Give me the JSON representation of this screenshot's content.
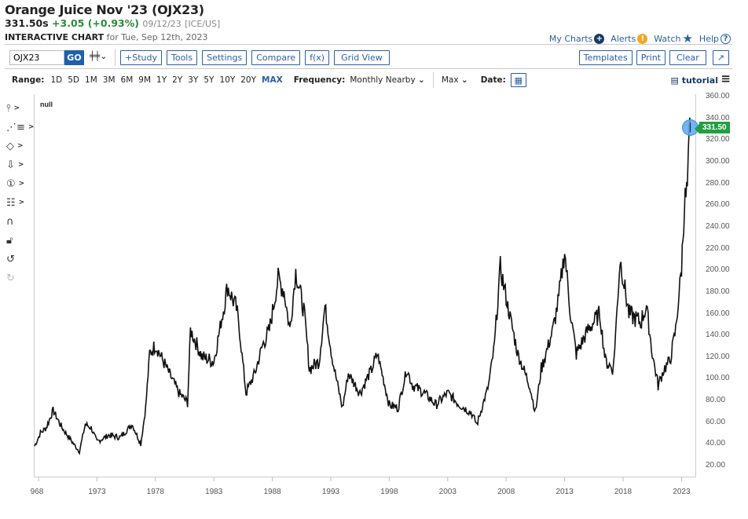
{
  "header": {
    "title": "Orange Juice Nov '23 (OJX23)",
    "price": "331.50s",
    "change": "+3.05 (+0.93%)",
    "date": "09/12/23",
    "exchange": "[ICE/US]",
    "sub_bold": "INTERACTIVE CHART",
    "sub_rest": "for Tue, Sep 12th, 2023"
  },
  "links": {
    "my_charts": "My Charts",
    "alerts": "Alerts",
    "watch": "Watch",
    "help": "Help"
  },
  "toolbar": {
    "symbol": "OJX23",
    "go": "GO",
    "study": "+Study",
    "tools": "Tools",
    "settings": "Settings",
    "compare": "Compare",
    "fx": "f(x)",
    "grid": "Grid View",
    "templates": "Templates",
    "print": "Print",
    "clear": "Clear",
    "expand": "↗"
  },
  "range": {
    "label": "Range:",
    "options": [
      "1D",
      "5D",
      "1M",
      "3M",
      "6M",
      "9M",
      "1Y",
      "2Y",
      "3Y",
      "5Y",
      "10Y",
      "20Y",
      "MAX"
    ],
    "active": "MAX",
    "freq_label": "Frequency:",
    "freq_value": "Monthly Nearby",
    "agg_value": "Max",
    "date_label": "Date:",
    "tutorial": "tutorial"
  },
  "left_tools": [
    "crosshair",
    "trendlines",
    "shapes",
    "arrow",
    "annotation-number",
    "fibonacci",
    "magnet",
    "lock",
    "undo",
    "redo"
  ],
  "colors": {
    "accent": "#2a5ea8",
    "up": "#2a8a3a",
    "last_price_badge": "#20a040",
    "marker": "#5aa8f0"
  },
  "chart_data": {
    "type": "line",
    "legend_text": "null",
    "last_value": "331.50",
    "ylim": [
      10,
      362
    ],
    "y_ticks": [
      "360.00",
      "340.00",
      "320.00",
      "300.00",
      "280.00",
      "260.00",
      "240.00",
      "220.00",
      "200.00",
      "180.00",
      "160.00",
      "140.00",
      "120.00",
      "100.00",
      "80.00",
      "60.00",
      "40.00",
      "20.00"
    ],
    "x_ticks": [
      "968",
      "1973",
      "1978",
      "1983",
      "1988",
      "1993",
      "1998",
      "2003",
      "2008",
      "2013",
      "2018",
      "2023"
    ],
    "grid": false,
    "series": [
      {
        "points": [
          [
            "1967-09",
            38
          ],
          [
            "1968-03",
            50
          ],
          [
            "1968-09",
            55
          ],
          [
            "1969-04",
            71
          ],
          [
            "1970-01",
            55
          ],
          [
            "1971-01",
            40
          ],
          [
            "1971-07",
            33
          ],
          [
            "1972-01",
            58
          ],
          [
            "1972-07",
            55
          ],
          [
            "1973-01",
            42
          ],
          [
            "1974-01",
            48
          ],
          [
            "1975-01",
            46
          ],
          [
            "1976-01",
            58
          ],
          [
            "1976-10",
            40
          ],
          [
            "1977-03",
            73
          ],
          [
            "1977-07",
            123
          ],
          [
            "1978-01",
            131
          ],
          [
            "1979-01",
            109
          ],
          [
            "1980-01",
            87
          ],
          [
            "1980-10",
            78
          ],
          [
            "1981-01",
            145
          ],
          [
            "1982-01",
            120
          ],
          [
            "1983-01",
            116
          ],
          [
            "1983-10",
            160
          ],
          [
            "1984-03",
            185
          ],
          [
            "1985-01",
            163
          ],
          [
            "1985-10",
            87
          ],
          [
            "1986-07",
            105
          ],
          [
            "1987-03",
            131
          ],
          [
            "1987-10",
            145
          ],
          [
            "1988-07",
            192
          ],
          [
            "1989-01",
            181
          ],
          [
            "1989-07",
            145
          ],
          [
            "1990-01",
            199
          ],
          [
            "1990-10",
            160
          ],
          [
            "1991-03",
            109
          ],
          [
            "1992-01",
            116
          ],
          [
            "1992-07",
            167
          ],
          [
            "1993-03",
            116
          ],
          [
            "1994-01",
            73
          ],
          [
            "1994-07",
            105
          ],
          [
            "1995-07",
            87
          ],
          [
            "1996-07",
            109
          ],
          [
            "1997-01",
            123
          ],
          [
            "1998-01",
            76
          ],
          [
            "1998-10",
            73
          ],
          [
            "1999-07",
            109
          ],
          [
            "2000-01",
            94
          ],
          [
            "2001-01",
            87
          ],
          [
            "2002-01",
            76
          ],
          [
            "2003-01",
            87
          ],
          [
            "2004-01",
            76
          ],
          [
            "2005-01",
            69
          ],
          [
            "2005-07",
            58
          ],
          [
            "2006-07",
            94
          ],
          [
            "2007-01",
            131
          ],
          [
            "2007-07",
            203
          ],
          [
            "2008-01",
            174
          ],
          [
            "2009-01",
            123
          ],
          [
            "2010-01",
            94
          ],
          [
            "2010-07",
            69
          ],
          [
            "2011-01",
            109
          ],
          [
            "2012-01",
            145
          ],
          [
            "2012-07",
            174
          ],
          [
            "2013-01",
            218
          ],
          [
            "2013-07",
            160
          ],
          [
            "2014-01",
            123
          ],
          [
            "2015-01",
            145
          ],
          [
            "2016-01",
            160
          ],
          [
            "2016-07",
            116
          ],
          [
            "2017-03",
            109
          ],
          [
            "2017-10",
            210
          ],
          [
            "2018-07",
            160
          ],
          [
            "2019-07",
            152
          ],
          [
            "2020-01",
            167
          ],
          [
            "2020-07",
            123
          ],
          [
            "2021-01",
            94
          ],
          [
            "2021-07",
            109
          ],
          [
            "2022-01",
            116
          ],
          [
            "2022-07",
            145
          ],
          [
            "2023-01",
            203
          ],
          [
            "2023-04",
            261
          ],
          [
            "2023-07",
            275
          ],
          [
            "2023-09",
            320
          ],
          [
            "2023-10",
            331.5
          ]
        ]
      }
    ]
  }
}
